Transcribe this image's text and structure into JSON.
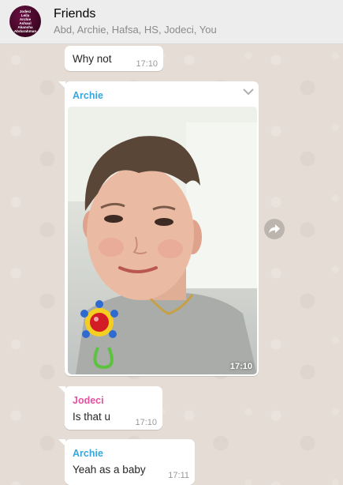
{
  "header": {
    "avatar_lines": [
      "Jodeci",
      "Leila",
      "Archie",
      "Ashaul",
      "Akansha",
      "Abdurahman"
    ],
    "title": "Friends",
    "subtitle": "Abd, Archie, Hafsa, HS, Jodeci, You"
  },
  "messages": [
    {
      "text": "Why not",
      "time": "17:10"
    },
    {
      "sender": "Archie",
      "sender_color": "#35a7e0",
      "type": "photo",
      "time": "17:10"
    },
    {
      "sender": "Jodeci",
      "sender_color": "#e5509f",
      "text": "Is that u",
      "time": "17:10"
    },
    {
      "sender": "Archie",
      "sender_color": "#35a7e0",
      "text": "Yeah as a baby",
      "time": "17:11"
    }
  ],
  "icons": {
    "menu": "chevron-down-icon",
    "forward": "forward-icon"
  }
}
